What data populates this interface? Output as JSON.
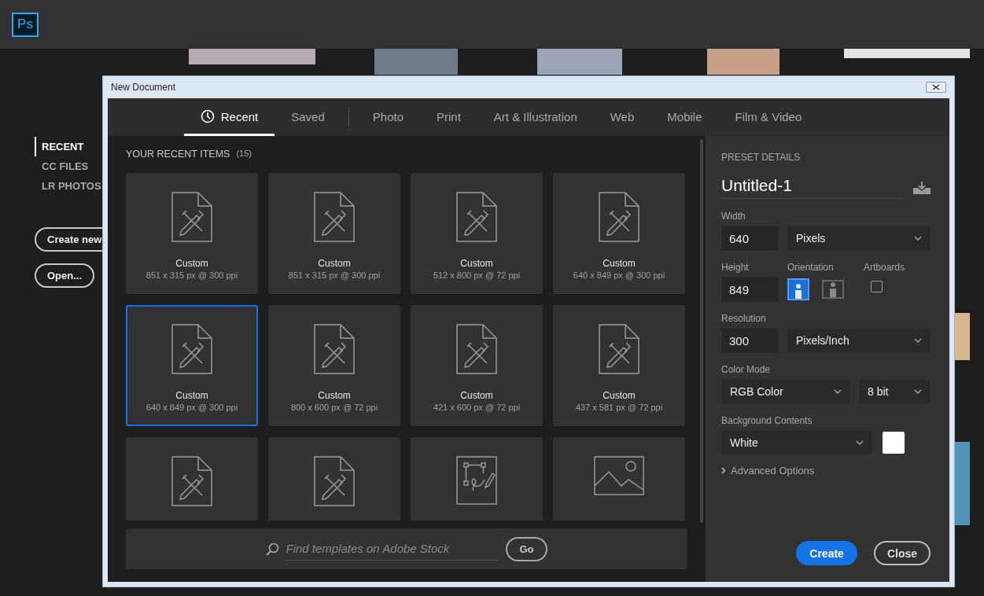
{
  "app": {
    "logo": "Ps"
  },
  "nav": {
    "items": [
      {
        "label": "RECENT",
        "selected": true
      },
      {
        "label": "CC FILES",
        "selected": false
      },
      {
        "label": "LR PHOTOS",
        "selected": false
      }
    ],
    "buttons": [
      "Create new",
      "Open..."
    ]
  },
  "dialog": {
    "title": "New Document",
    "tab_groups": [
      [
        {
          "label": "Recent",
          "selected": true
        },
        {
          "label": "Saved",
          "selected": false
        }
      ],
      [
        {
          "label": "Photo",
          "selected": false
        },
        {
          "label": "Print",
          "selected": false
        },
        {
          "label": "Art & Illustration",
          "selected": false
        },
        {
          "label": "Web",
          "selected": false
        },
        {
          "label": "Mobile",
          "selected": false
        },
        {
          "label": "Film & Video",
          "selected": false
        }
      ]
    ],
    "recent": {
      "heading": "YOUR RECENT ITEMS",
      "count": "(15)",
      "items": [
        {
          "kind": "document",
          "name": "Custom",
          "size": "851 x 315 px @ 300 ppi",
          "selected": false
        },
        {
          "kind": "document",
          "name": "Custom",
          "size": "851 x 315 px @ 300 ppi",
          "selected": false
        },
        {
          "kind": "document",
          "name": "Custom",
          "size": "512 x 800 px @ 72 ppi",
          "selected": false
        },
        {
          "kind": "document",
          "name": "Custom",
          "size": "640 x 849 px @ 300 ppi",
          "selected": false
        },
        {
          "kind": "document",
          "name": "Custom",
          "size": "640 x 849 px @ 300 ppi",
          "selected": true
        },
        {
          "kind": "document",
          "name": "Custom",
          "size": "800 x 600 px @ 72 ppi",
          "selected": false
        },
        {
          "kind": "document",
          "name": "Custom",
          "size": "421 x 600 px @ 72 ppi",
          "selected": false
        },
        {
          "kind": "document",
          "name": "Custom",
          "size": "437 x 581 px @ 72 ppi",
          "selected": false
        },
        {
          "kind": "document",
          "selected": false
        },
        {
          "kind": "document",
          "selected": false
        },
        {
          "kind": "artboard",
          "selected": false
        },
        {
          "kind": "image",
          "selected": false
        }
      ]
    },
    "search": {
      "placeholder": "Find templates on Adobe Stock",
      "button": "Go"
    },
    "preset": {
      "heading": "PRESET DETAILS",
      "name": "Untitled-1",
      "width": {
        "label": "Width",
        "value": "640",
        "unit": "Pixels"
      },
      "height": {
        "label": "Height",
        "value": "849"
      },
      "orientation": {
        "label": "Orientation",
        "options": [
          {
            "kind": "portrait",
            "selected": true
          },
          {
            "kind": "landscape",
            "selected": false
          }
        ]
      },
      "artboards": {
        "label": "Artboards",
        "checked": false
      },
      "resolution": {
        "label": "Resolution",
        "value": "300",
        "unit": "Pixels/Inch"
      },
      "color_mode": {
        "label": "Color Mode",
        "mode": "RGB Color",
        "depth": "8 bit"
      },
      "background": {
        "label": "Background Contents",
        "value": "White",
        "color": "#ffffff"
      },
      "advanced": {
        "label": "Advanced Options",
        "expanded": false
      }
    },
    "buttons": [
      {
        "kind": "primary",
        "label": "Create"
      },
      {
        "kind": "secondary",
        "label": "Close"
      }
    ]
  }
}
